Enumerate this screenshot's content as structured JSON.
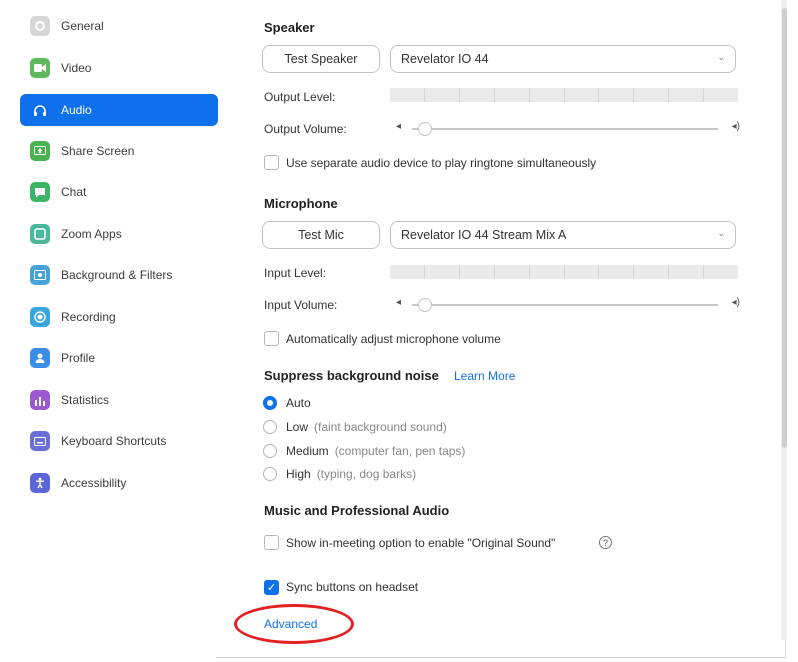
{
  "sidebar": {
    "items": [
      {
        "label": "General",
        "icon": "gear-icon",
        "color": "#d6d6d6",
        "active": false
      },
      {
        "label": "Video",
        "icon": "video-icon",
        "color": "#5fb85c",
        "active": false
      },
      {
        "label": "Audio",
        "icon": "headphones-icon",
        "color": "#0e71eb",
        "active": true
      },
      {
        "label": "Share Screen",
        "icon": "share-screen-icon",
        "color": "#4caf50",
        "active": false
      },
      {
        "label": "Chat",
        "icon": "chat-icon",
        "color": "#40b36a",
        "active": false
      },
      {
        "label": "Zoom Apps",
        "icon": "apps-icon",
        "color": "#4bb89a",
        "active": false
      },
      {
        "label": "Background & Filters",
        "icon": "background-icon",
        "color": "#45a5d8",
        "active": false
      },
      {
        "label": "Recording",
        "icon": "recording-icon",
        "color": "#3aa6e0",
        "active": false
      },
      {
        "label": "Profile",
        "icon": "profile-icon",
        "color": "#3b8ee8",
        "active": false
      },
      {
        "label": "Statistics",
        "icon": "statistics-icon",
        "color": "#9b59d0",
        "active": false
      },
      {
        "label": "Keyboard Shortcuts",
        "icon": "keyboard-icon",
        "color": "#6a6fd6",
        "active": false
      },
      {
        "label": "Accessibility",
        "icon": "accessibility-icon",
        "color": "#5b66d8",
        "active": false
      }
    ]
  },
  "speaker": {
    "title": "Speaker",
    "test_button": "Test Speaker",
    "device": "Revelator IO 44",
    "output_level_label": "Output Level:",
    "output_volume_label": "Output Volume:",
    "output_volume_level": 0.02,
    "ringtone_checkbox": "Use separate audio device to play ringtone simultaneously",
    "ringtone_checked": false
  },
  "microphone": {
    "title": "Microphone",
    "test_button": "Test Mic",
    "device": "Revelator IO 44 Stream Mix A",
    "input_level_label": "Input Level:",
    "input_volume_label": "Input Volume:",
    "input_volume_level": 0.02,
    "auto_adjust_checkbox": "Automatically adjust microphone volume",
    "auto_adjust_checked": false
  },
  "noise": {
    "title": "Suppress background noise",
    "learn_more": "Learn More",
    "options": [
      {
        "label": "Auto",
        "hint": "",
        "selected": true
      },
      {
        "label": "Low",
        "hint": "(faint background sound)",
        "selected": false
      },
      {
        "label": "Medium",
        "hint": "(computer fan, pen taps)",
        "selected": false
      },
      {
        "label": "High",
        "hint": "(typing, dog barks)",
        "selected": false
      }
    ]
  },
  "music": {
    "title": "Music and Professional Audio",
    "original_sound_checkbox": "Show in-meeting option to enable \"Original Sound\"",
    "original_sound_checked": false
  },
  "headset": {
    "sync_checkbox": "Sync buttons on headset",
    "sync_checked": true
  },
  "advanced_link": "Advanced",
  "colors": {
    "accent": "#0e71eb",
    "highlight": "#e02121"
  }
}
